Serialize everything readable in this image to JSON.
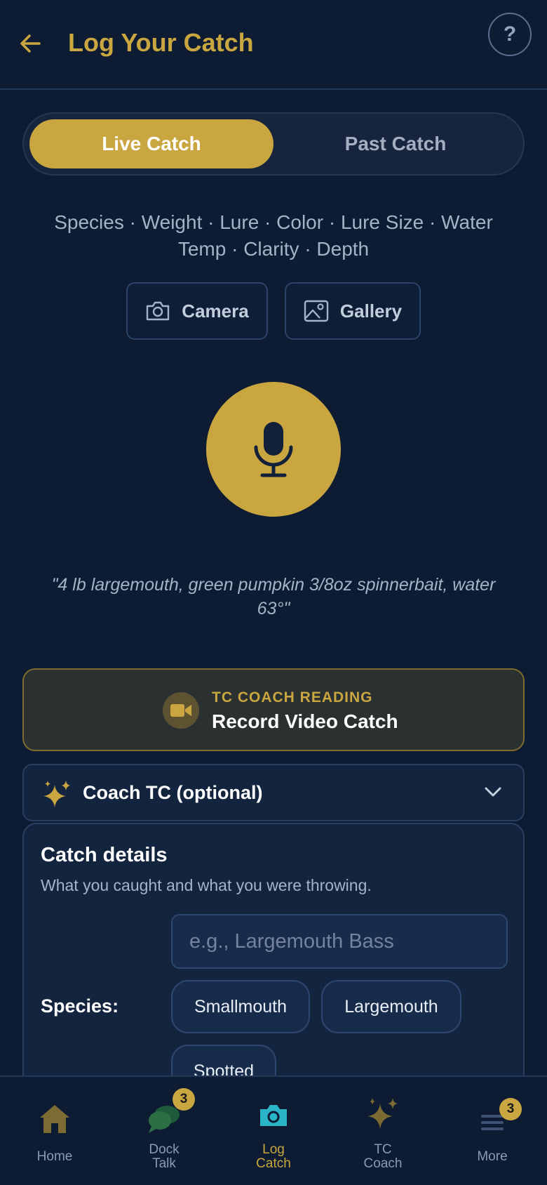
{
  "header": {
    "title": "Log Your Catch",
    "help_label": "?"
  },
  "mode_toggle": {
    "options": [
      "Live Catch",
      "Past Catch"
    ],
    "selected": "Live Catch"
  },
  "fields_hint": "Species · Weight · Lure · Color · Lure Size · Water Temp · Clarity · Depth",
  "media_buttons": {
    "camera": "Camera",
    "gallery": "Gallery"
  },
  "voice": {
    "example": "\"4 lb largemouth, green pumpkin 3/8oz spinnerbait, water 63°\""
  },
  "video_card": {
    "eyebrow": "TC COACH READING",
    "title": "Record Video Catch"
  },
  "coach": {
    "label": "Coach TC (optional)"
  },
  "catch_details": {
    "title": "Catch details",
    "subtitle": "What you caught and what you were throwing.",
    "species_label": "Species:",
    "species_placeholder": "e.g., Largemouth Bass",
    "species_value": "",
    "species_chips": [
      "Smallmouth",
      "Largemouth",
      "Spotted"
    ]
  },
  "bottom_nav": {
    "items": [
      {
        "label": "Home",
        "icon": "home-icon",
        "badge": null
      },
      {
        "label": "Dock\nTalk",
        "icon": "chat-icon",
        "badge": "3"
      },
      {
        "label": "Log\nCatch",
        "icon": "camera-icon",
        "badge": null,
        "active": true
      },
      {
        "label": "TC\nCoach",
        "icon": "sparkle-icon",
        "badge": null
      },
      {
        "label": "More",
        "icon": "menu-icon",
        "badge": "3"
      }
    ],
    "home": "Home",
    "dock_talk_1": "Dock",
    "dock_talk_2": "Talk",
    "log_catch_1": "Log",
    "log_catch_2": "Catch",
    "tc_coach_1": "TC",
    "tc_coach_2": "Coach",
    "more": "More",
    "dock_badge": "3",
    "more_badge": "3"
  },
  "colors": {
    "background": "#0d1b33",
    "accent_gold": "#c9a640",
    "camera_teal": "#2bb4c8"
  }
}
